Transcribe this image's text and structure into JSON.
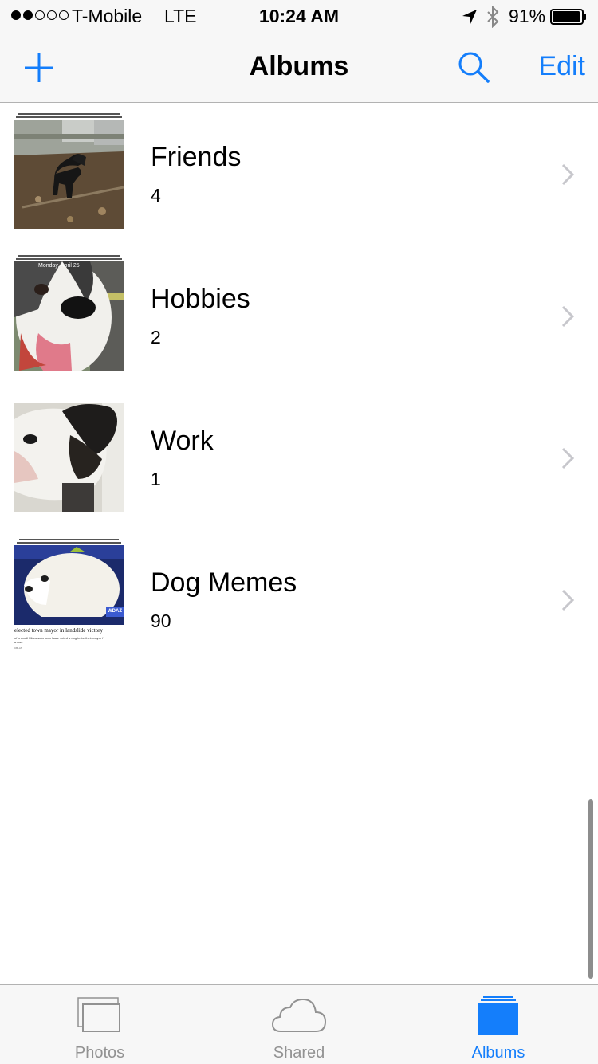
{
  "status_bar": {
    "carrier": "T-Mobile",
    "network": "LTE",
    "time": "10:24 AM",
    "battery_percent": "91%",
    "signal_strength": 2,
    "battery_level": 0.91
  },
  "nav": {
    "title": "Albums",
    "edit_label": "Edit",
    "icons": [
      "plus-icon",
      "search-icon"
    ]
  },
  "albums": [
    {
      "name": "Friends",
      "count": "4"
    },
    {
      "name": "Hobbies",
      "count": "2"
    },
    {
      "name": "Work",
      "count": "1"
    },
    {
      "name": "Dog Memes",
      "count": "90"
    }
  ],
  "thumbnail_text": {
    "hobbies_date": "Monday, April 25",
    "memes_headline": "elected town mayor in landslide victory",
    "memes_subtext": "of a small Minnesota town have voted a dog to be their mayor f",
    "memes_subtext2": "a row.",
    "memes_credit": "CBLAS",
    "memes_logo": "WDAZ"
  },
  "tabs": [
    {
      "label": "Photos",
      "icon": "photos-icon",
      "active": false
    },
    {
      "label": "Shared",
      "icon": "cloud-icon",
      "active": false
    },
    {
      "label": "Albums",
      "icon": "albums-icon",
      "active": true
    }
  ],
  "colors": {
    "accent": "#147efb",
    "inactive_tab": "#929292",
    "bar_background": "#f7f7f7",
    "chevron": "#c7c7cc"
  }
}
